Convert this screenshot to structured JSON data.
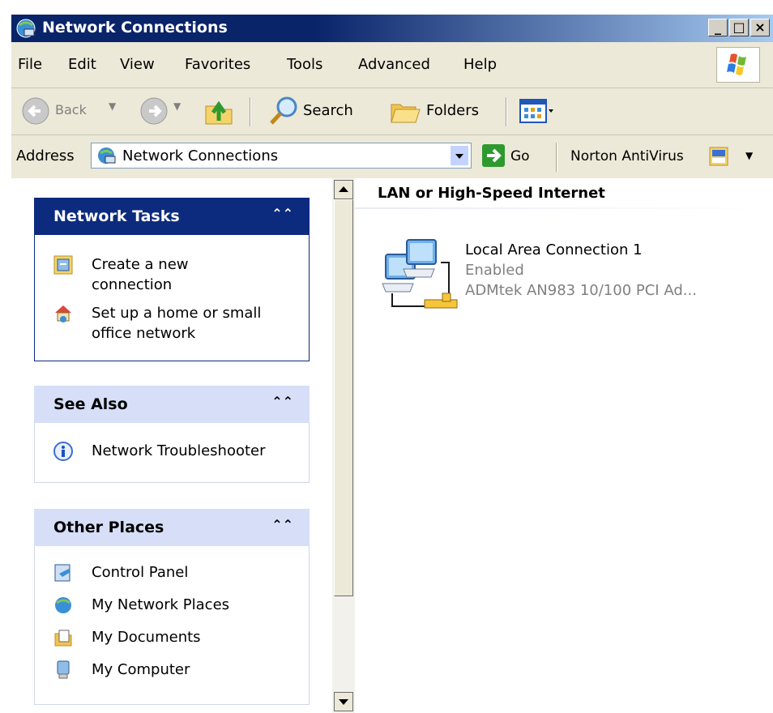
{
  "window": {
    "title": "Network Connections"
  },
  "menu": [
    "File",
    "Edit",
    "View",
    "Favorites",
    "Tools",
    "Advanced",
    "Help"
  ],
  "toolbar": {
    "back": "Back",
    "search": "Search",
    "folders": "Folders"
  },
  "address": {
    "label": "Address",
    "value": "Network Connections",
    "go": "Go",
    "norton": "Norton AntiVirus"
  },
  "panels": {
    "network_tasks": {
      "title": "Network Tasks",
      "items": [
        [
          "Create a new",
          "connection"
        ],
        [
          "Set up a home or small",
          "office network"
        ]
      ]
    },
    "see_also": {
      "title": "See Also",
      "items": [
        "Network Troubleshooter"
      ]
    },
    "other_places": {
      "title": "Other Places",
      "items": [
        "Control Panel",
        "My Network Places",
        "My Documents",
        "My Computer"
      ]
    }
  },
  "main": {
    "group": "LAN or High-Speed Internet",
    "connection": {
      "name": "Local Area Connection 1",
      "status": "Enabled",
      "device": "ADMtek AN983 10/100 PCI Ad..."
    }
  },
  "colors": {
    "title_gradient_start": "#0a246a",
    "panel_header_blue": "#0c2b7e",
    "chrome": "#ece9d8"
  },
  "icons": {
    "title": "network-connections-icon",
    "tasks": [
      "new-connection-icon",
      "home-network-icon"
    ],
    "see_also": [
      "info-icon"
    ],
    "other_places": [
      "control-panel-icon",
      "my-network-places-icon",
      "my-documents-icon",
      "my-computer-icon"
    ]
  }
}
